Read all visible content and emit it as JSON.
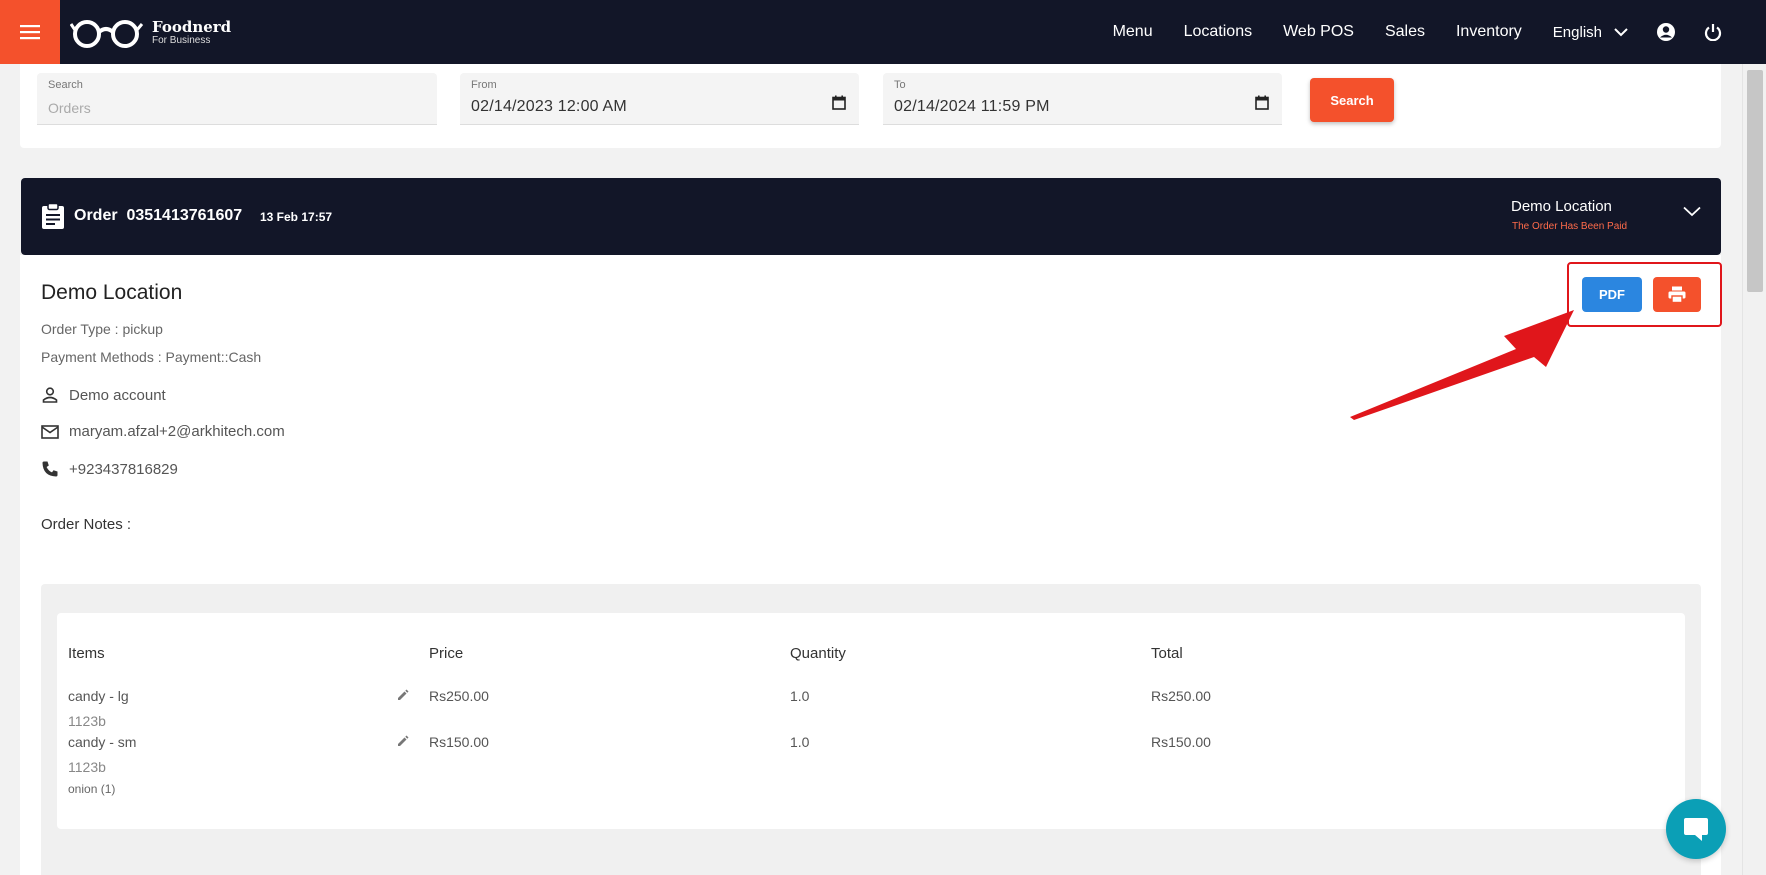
{
  "app": {
    "brand_name": "Foodnerd",
    "brand_sub": "For Business"
  },
  "nav": {
    "items": [
      "Menu",
      "Locations",
      "Web POS",
      "Sales",
      "Inventory"
    ],
    "language": "English"
  },
  "filters": {
    "search": {
      "label": "Search",
      "placeholder": "Orders",
      "value": ""
    },
    "from": {
      "label": "From",
      "value": "02/14/2023 12:00 AM"
    },
    "to": {
      "label": "To",
      "value": "02/14/2024 11:59 PM"
    },
    "search_button": "Search"
  },
  "order": {
    "title": "Order  0351413761607",
    "date": "13 Feb 17:57",
    "location": "Demo Location",
    "status": "The Order Has Been Paid",
    "detail": {
      "location_title": "Demo Location",
      "order_type": "Order Type : pickup",
      "payment_methods": "Payment Methods : Payment::Cash",
      "customer_name": "Demo account",
      "email": "maryam.afzal+2@arkhitech.com",
      "phone": "+923437816829",
      "notes_label": "Order Notes :"
    },
    "actions": {
      "pdf_label": "PDF"
    },
    "table": {
      "headers": [
        "Items",
        "Price",
        "Quantity",
        "Total"
      ],
      "rows": [
        {
          "item": "candy - lg",
          "code": "1123b",
          "extra": "",
          "price": "Rs250.00",
          "quantity": "1.0",
          "total": "Rs250.00"
        },
        {
          "item": "candy - sm",
          "code": "1123b",
          "extra": "onion (1)",
          "price": "Rs150.00",
          "quantity": "1.0",
          "total": "Rs150.00"
        }
      ]
    }
  },
  "colors": {
    "nav_bg": "#121628",
    "accent": "#f4512c",
    "pdf_blue": "#2b86e0",
    "annotation_red": "#e0161b",
    "chat_teal": "#0b9fb6"
  },
  "icons": [
    "hamburger-menu-icon",
    "glasses-logo-icon",
    "chevron-down-icon",
    "account-circle-icon",
    "power-icon",
    "calendar-icon",
    "clipboard-icon",
    "person-icon",
    "email-icon",
    "phone-icon",
    "printer-icon",
    "pencil-icon",
    "chat-icon"
  ]
}
